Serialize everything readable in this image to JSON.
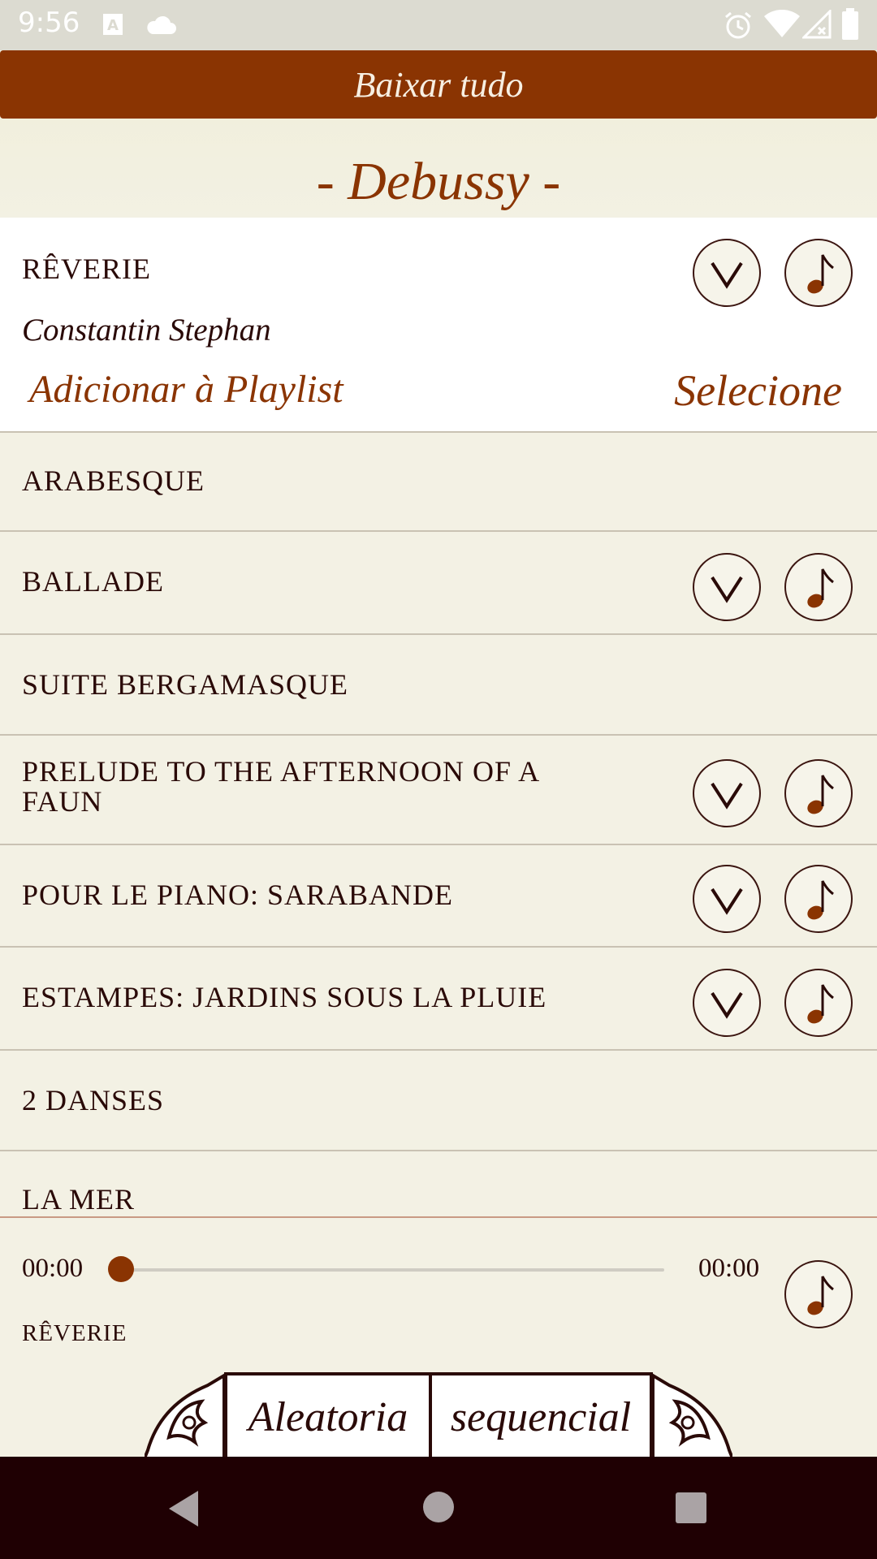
{
  "status_bar": {
    "time": "9:56"
  },
  "download_all": "Baixar tudo",
  "composer": "- Debussy -",
  "expanded_track": {
    "title": "RÊVERIE",
    "performer": "Constantin Stephan",
    "add_to_playlist": "Adicionar à Playlist",
    "select": "Selecione"
  },
  "tracks": [
    {
      "title": "ARABESQUE",
      "has_buttons": false
    },
    {
      "title": "BALLADE",
      "has_buttons": true
    },
    {
      "title": "SUITE BERGAMASQUE",
      "has_buttons": false
    },
    {
      "title": "PRELUDE TO THE AFTERNOON OF A FAUN",
      "has_buttons": true
    },
    {
      "title": "POUR LE PIANO: SARABANDE",
      "has_buttons": true
    },
    {
      "title": "ESTAMPES: JARDINS SOUS LA PLUIE",
      "has_buttons": true
    },
    {
      "title": "2 DANSES",
      "has_buttons": false
    },
    {
      "title": "LA MER",
      "has_buttons": false
    }
  ],
  "player": {
    "elapsed": "00:00",
    "duration": "00:00",
    "progress": 0,
    "now_playing": "RÊVERIE"
  },
  "modes": {
    "random": "Aleatoria",
    "sequential": "sequencial"
  },
  "colors": {
    "accent": "#8a3402",
    "dark": "#2a0a08",
    "background": "#f3f1e4",
    "nav": "#1f0003"
  }
}
